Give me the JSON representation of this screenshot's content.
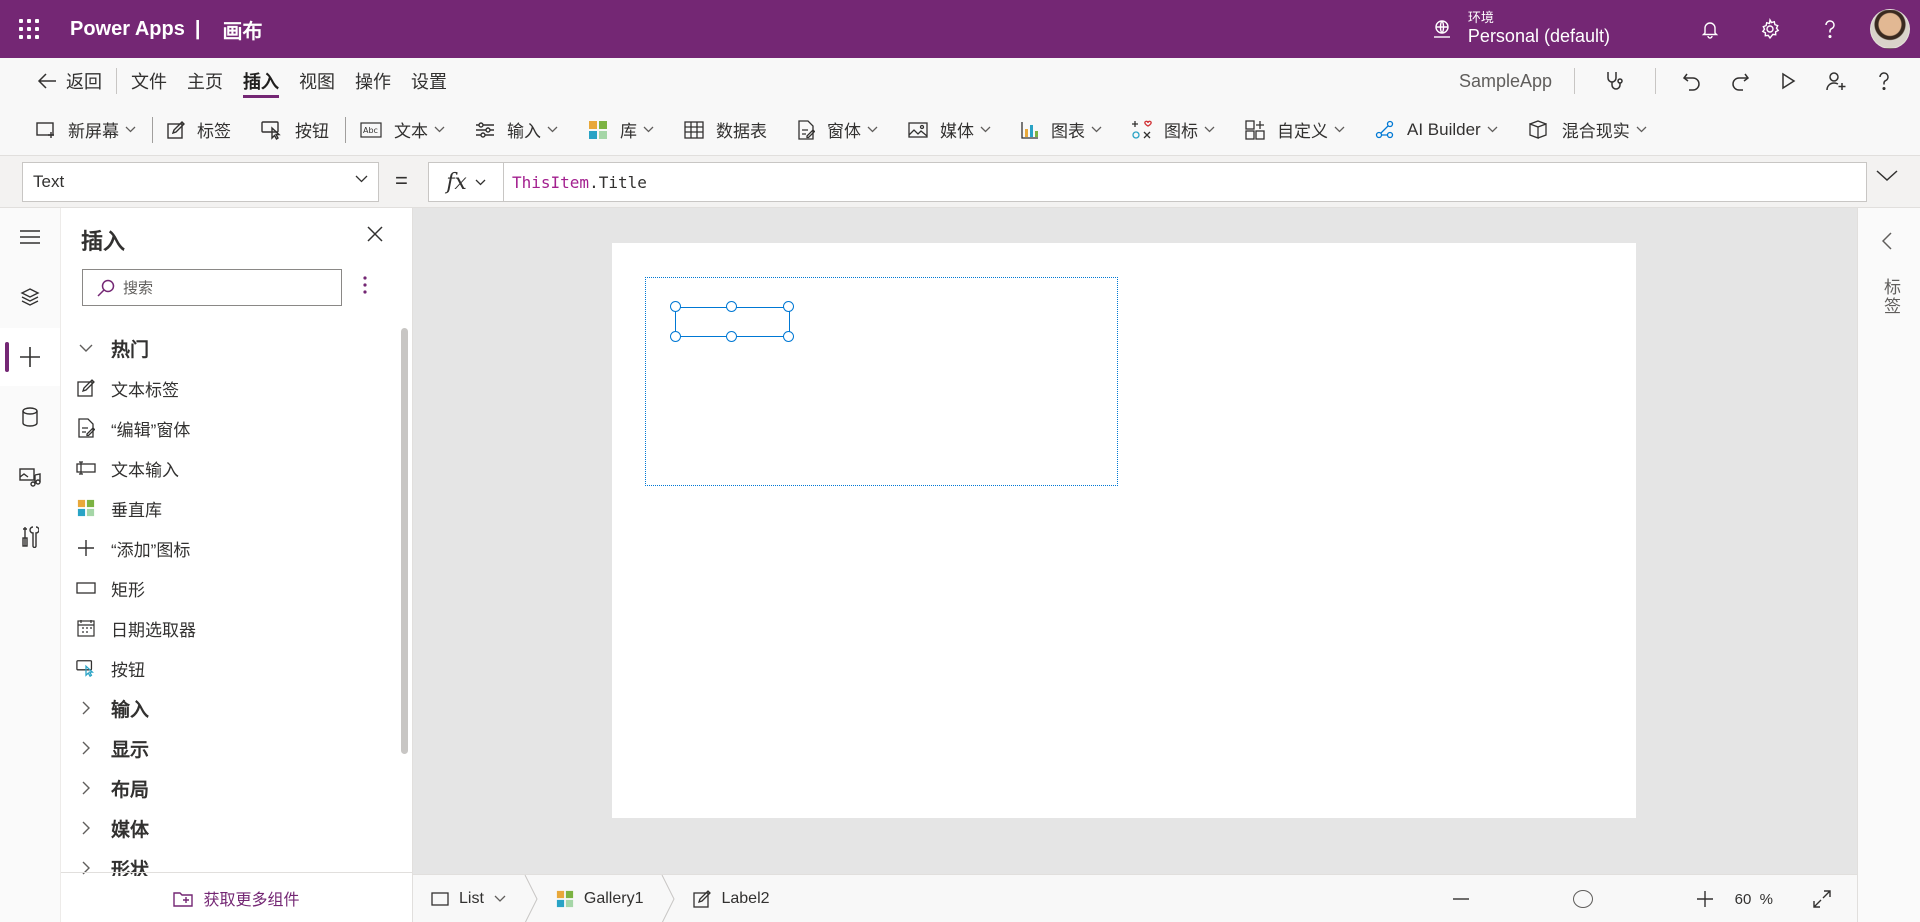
{
  "topbar": {
    "app_name": "Power Apps",
    "separator": "|",
    "section": "画布",
    "env_label": "环境",
    "env_name": "Personal (default)",
    "bg_color": "#742774"
  },
  "menu": {
    "back": "返回",
    "items": [
      "文件",
      "主页",
      "插入",
      "视图",
      "操作",
      "设置"
    ],
    "active": "插入",
    "app_label": "SampleApp"
  },
  "ribbon": {
    "items": [
      "新屏幕",
      "标签",
      "按钮",
      "文本",
      "输入",
      "库",
      "数据表",
      "窗体",
      "媒体",
      "图表",
      "图标",
      "自定义",
      "AI Builder",
      "混合现实"
    ]
  },
  "formula": {
    "property": "Text",
    "equals": "=",
    "fx": "fx",
    "expr_object": "ThisItem",
    "expr_rest": ".Title"
  },
  "panel": {
    "title": "插入",
    "search_placeholder": "搜索",
    "popular_header": "热门",
    "popular_items": [
      "文本标签",
      "“编辑”窗体",
      "文本输入",
      "垂直库",
      "“添加”图标",
      "矩形",
      "日期选取器",
      "按钮"
    ],
    "categories": [
      "输入",
      "显示",
      "布局",
      "媒体",
      "形状"
    ],
    "footer_link": "获取更多组件"
  },
  "right_panel": {
    "label": "标签"
  },
  "statusbar": {
    "crumbs": [
      "List",
      "Gallery1",
      "Label2"
    ],
    "zoom_value": "60",
    "zoom_unit": "%"
  }
}
